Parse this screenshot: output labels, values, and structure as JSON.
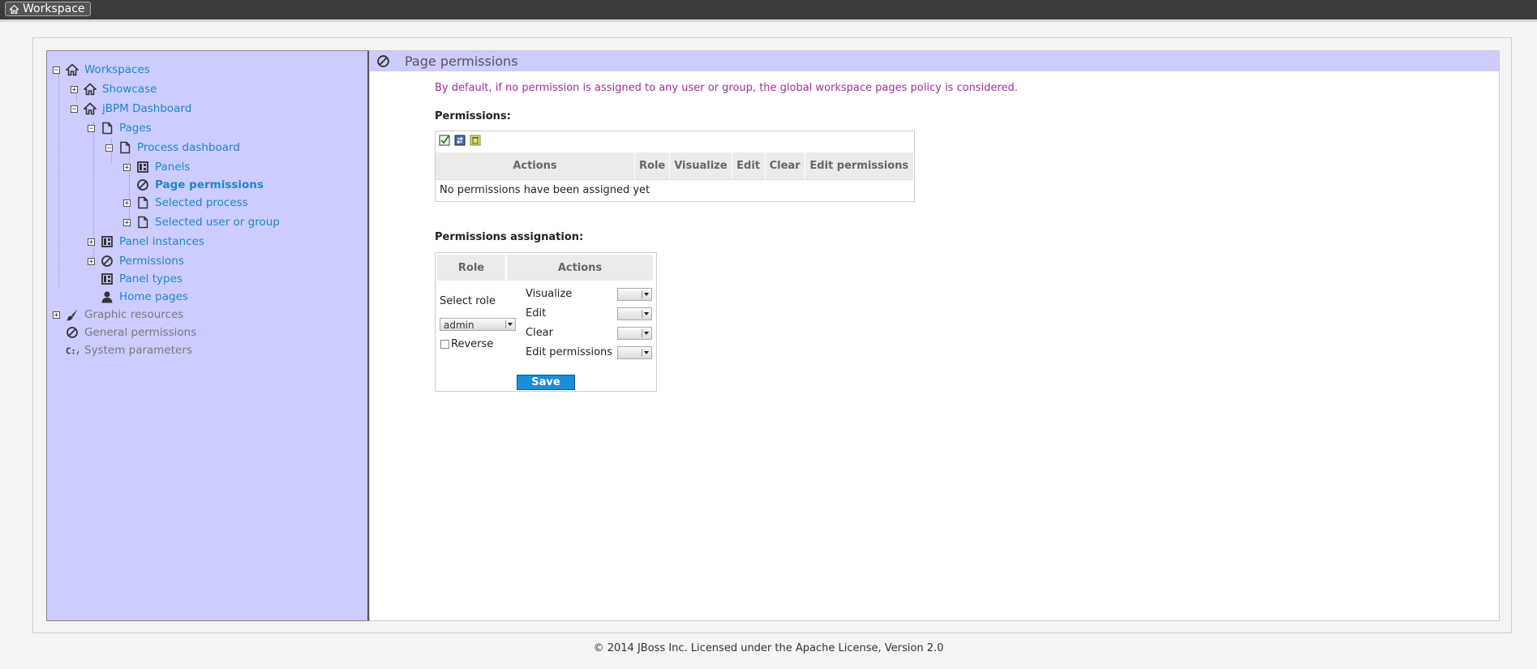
{
  "topbar": {
    "workspace_label": "Workspace",
    "icon": "home-icon"
  },
  "tree": {
    "items": [
      {
        "label": "Workspaces",
        "expander": "⊟",
        "icon": "home-icon",
        "style": "link"
      },
      {
        "label": "Showcase",
        "expander": "⊞",
        "icon": "home-icon",
        "style": "link"
      },
      {
        "label": "jBPM Dashboard",
        "expander": "⊟",
        "icon": "home-icon",
        "style": "link"
      },
      {
        "label": "Pages",
        "expander": "⊟",
        "icon": "page-icon",
        "style": "link"
      },
      {
        "label": "Process dashboard",
        "expander": "⊟",
        "icon": "page-icon",
        "style": "link"
      },
      {
        "label": "Panels",
        "expander": "⊞",
        "icon": "panel-icon",
        "style": "link"
      },
      {
        "label": "Page permissions",
        "expander": "",
        "icon": "prohibited-icon",
        "style": "active"
      },
      {
        "label": "Selected process",
        "expander": "⊞",
        "icon": "page-icon",
        "style": "link"
      },
      {
        "label": "Selected user or group",
        "expander": "⊞",
        "icon": "page-icon",
        "style": "link"
      },
      {
        "label": "Panel instances",
        "expander": "⊞",
        "icon": "panel-icon",
        "style": "link"
      },
      {
        "label": "Permissions",
        "expander": "⊞",
        "icon": "prohibited-icon",
        "style": "link"
      },
      {
        "label": "Panel types",
        "expander": "",
        "icon": "panel-icon",
        "style": "link"
      },
      {
        "label": "Home pages",
        "expander": "",
        "icon": "user-icon",
        "style": "link"
      },
      {
        "label": "Graphic resources",
        "expander": "⊞",
        "icon": "brush-icon",
        "style": "gray"
      },
      {
        "label": "General permissions",
        "expander": "",
        "icon": "prohibited-icon",
        "style": "gray"
      },
      {
        "label": "System parameters",
        "expander": "",
        "icon": "terminal-icon",
        "style": "gray"
      }
    ]
  },
  "main": {
    "title": "Page permissions",
    "title_icon": "prohibited-icon",
    "note": "By default, if no permission is assigned to any user or group, the global workspace pages policy is considered.",
    "permissions_label": "Permissions:",
    "toolbar_icons": [
      "select-all-icon",
      "invert-icon",
      "delete-icon"
    ],
    "table": {
      "headers": [
        "Actions",
        "Role",
        "Visualize",
        "Edit",
        "Clear",
        "Edit permissions"
      ],
      "empty_message": "No permissions have been assigned yet"
    },
    "assignment_label": "Permissions assignation:",
    "assignment": {
      "role_header": "Role",
      "actions_header": "Actions",
      "select_role_label": "Select role",
      "role_value": "admin",
      "reverse_label": "Reverse",
      "actions": [
        "Visualize",
        "Edit",
        "Clear",
        "Edit permissions"
      ],
      "save_label": "Save"
    }
  },
  "footer": {
    "text": "© 2014 JBoss Inc. Licensed under the Apache License, Version 2.0"
  },
  "colors": {
    "sidebar_bg": "#ccccff",
    "link": "#1e88c8",
    "note": "#a0309a",
    "save_button": "#1a8ed6"
  }
}
